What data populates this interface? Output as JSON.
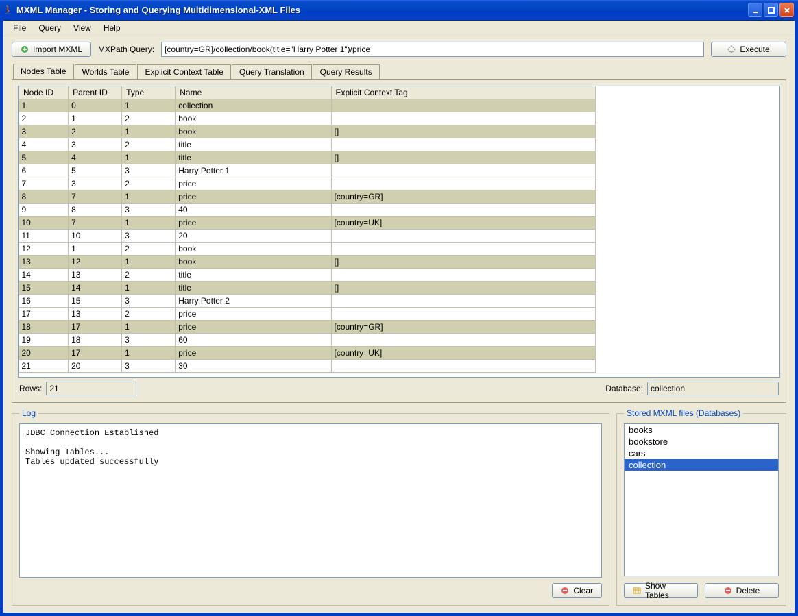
{
  "window": {
    "title": "MXML Manager - Storing and Querying Multidimensional-XML Files"
  },
  "menu": {
    "items": [
      "File",
      "Query",
      "View",
      "Help"
    ]
  },
  "toolbar": {
    "import_label": "Import MXML",
    "query_label": "MXPath Query:",
    "query_value": "[country=GR]/collection/book(title=\"Harry Potter 1\")/price",
    "execute_label": "Execute"
  },
  "tabs": [
    "Nodes Table",
    "Worlds Table",
    "Explicit Context Table",
    "Query Translation",
    "Query Results"
  ],
  "active_tab": 0,
  "table": {
    "columns": [
      "Node ID",
      "Parent ID",
      "Type",
      "Name",
      "Explicit Context Tag"
    ],
    "rows": [
      [
        "1",
        "0",
        "1",
        "collection",
        ""
      ],
      [
        "2",
        "1",
        "2",
        "book",
        ""
      ],
      [
        "3",
        "2",
        "1",
        "book",
        "[]"
      ],
      [
        "4",
        "3",
        "2",
        "title",
        ""
      ],
      [
        "5",
        "4",
        "1",
        "title",
        "[]"
      ],
      [
        "6",
        "5",
        "3",
        "Harry Potter 1",
        ""
      ],
      [
        "7",
        "3",
        "2",
        "price",
        ""
      ],
      [
        "8",
        "7",
        "1",
        "price",
        "[country=GR]"
      ],
      [
        "9",
        "8",
        "3",
        "40",
        ""
      ],
      [
        "10",
        "7",
        "1",
        "price",
        "[country=UK]"
      ],
      [
        "11",
        "10",
        "3",
        "20",
        ""
      ],
      [
        "12",
        "1",
        "2",
        "book",
        ""
      ],
      [
        "13",
        "12",
        "1",
        "book",
        "[]"
      ],
      [
        "14",
        "13",
        "2",
        "title",
        ""
      ],
      [
        "15",
        "14",
        "1",
        "title",
        "[]"
      ],
      [
        "16",
        "15",
        "3",
        "Harry Potter 2",
        ""
      ],
      [
        "17",
        "13",
        "2",
        "price",
        ""
      ],
      [
        "18",
        "17",
        "1",
        "price",
        "[country=GR]"
      ],
      [
        "19",
        "18",
        "3",
        "60",
        ""
      ],
      [
        "20",
        "17",
        "1",
        "price",
        "[country=UK]"
      ],
      [
        "21",
        "20",
        "3",
        "30",
        ""
      ]
    ]
  },
  "status": {
    "rows_label": "Rows:",
    "rows_value": "21",
    "db_label": "Database:",
    "db_value": "collection"
  },
  "log": {
    "title": "Log",
    "content": "JDBC Connection Established\n\nShowing Tables...\nTables updated successfully",
    "clear_label": "Clear"
  },
  "stored": {
    "title": "Stored MXML files (Databases)",
    "items": [
      "books",
      "bookstore",
      "cars",
      "collection"
    ],
    "selected_index": 3,
    "show_label": "Show Tables",
    "delete_label": "Delete"
  }
}
